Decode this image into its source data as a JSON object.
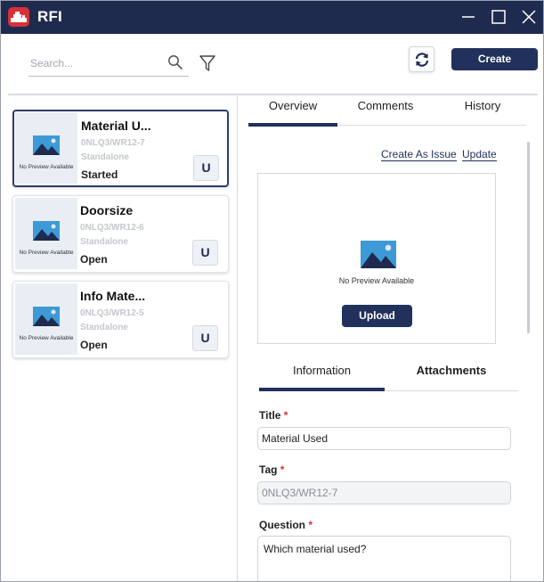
{
  "window": {
    "title": "RFI",
    "controls": [
      "minimize-icon",
      "maximize-icon",
      "close-icon"
    ]
  },
  "colors": {
    "titlebar": "#1f2a4f",
    "primary_button": "#22315c",
    "logo": "#d8303a",
    "required": "#d8303a"
  },
  "toolbar": {
    "search_placeholder": "Search...",
    "search_value": "",
    "search_icon": "search-icon",
    "filter_icon": "filter-icon",
    "sync_icon": "sync-icon",
    "create_label": "Create"
  },
  "cards": [
    {
      "title": "Material U...",
      "tag": "0NLQ3/WR12-7",
      "type": "Standalone",
      "status": "Started",
      "badge": "U",
      "preview_text": "No Preview Available",
      "selected": true
    },
    {
      "title": "Doorsize",
      "tag": "0NLQ3/WR12-6",
      "type": "Standalone",
      "status": "Open",
      "badge": "U",
      "preview_text": "No Preview Available",
      "selected": false
    },
    {
      "title": "Info Mate...",
      "tag": "0NLQ3/WR12-5",
      "type": "Standalone",
      "status": "Open",
      "badge": "U",
      "preview_text": "No Preview Available",
      "selected": false
    }
  ],
  "detail": {
    "tabs": [
      {
        "label": "Overview",
        "active": true
      },
      {
        "label": "Comments",
        "active": false
      },
      {
        "label": "History",
        "active": false
      }
    ],
    "links": {
      "create_issue": "Create As Issue",
      "update": "Update"
    },
    "preview": {
      "text": "No Preview Available",
      "upload_label": "Upload"
    },
    "subtabs": [
      {
        "label": "Information",
        "active": true
      },
      {
        "label": "Attachments",
        "active": false
      }
    ],
    "fields": {
      "title_label": "Title",
      "title_value": "Material Used",
      "tag_label": "Tag",
      "tag_value": "0NLQ3/WR12-7",
      "question_label": "Question",
      "question_value": "Which material used?",
      "required_mark": "*"
    }
  }
}
